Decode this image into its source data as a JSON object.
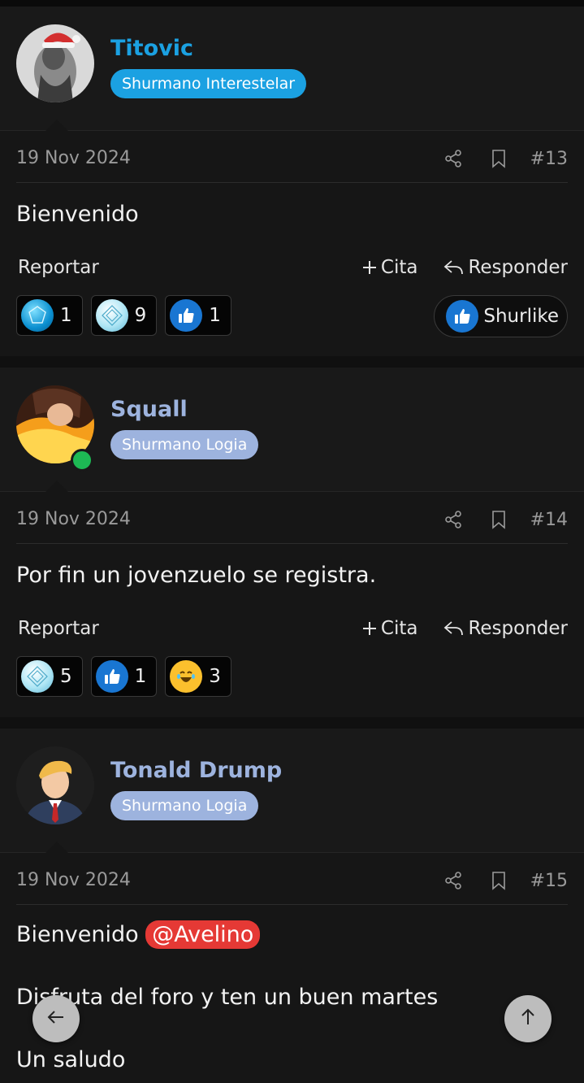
{
  "colors": {
    "accent_cyan": "#1ba1e2",
    "accent_slate": "#9db3de",
    "mention_red": "#e53935",
    "online_green": "#1db954"
  },
  "posts": [
    {
      "username": "Titovic",
      "badge": "Shurmano Interestelar",
      "date": "19 Nov 2024",
      "number": "#13",
      "body": [
        "Bienvenido"
      ],
      "actions": {
        "report": "Reportar",
        "quote": "Cita",
        "reply": "Responder"
      },
      "reactions": [
        {
          "icon": "sapphire-icon",
          "count": "1"
        },
        {
          "icon": "diamond-icon",
          "count": "9"
        },
        {
          "icon": "thumbs-up-icon",
          "count": "1"
        }
      ],
      "like_button": "Shurlike"
    },
    {
      "username": "Squall",
      "badge": "Shurmano Logia",
      "date": "19 Nov 2024",
      "number": "#14",
      "online": true,
      "body": [
        "Por fin un jovenzuelo se registra."
      ],
      "actions": {
        "report": "Reportar",
        "quote": "Cita",
        "reply": "Responder"
      },
      "reactions": [
        {
          "icon": "diamond-icon",
          "count": "5"
        },
        {
          "icon": "thumbs-up-icon",
          "count": "1"
        },
        {
          "icon": "laughing-icon",
          "count": "3"
        }
      ]
    },
    {
      "username": "Tonald Drump",
      "badge": "Shurmano Logia",
      "date": "19 Nov 2024",
      "number": "#15",
      "body_prefix": "Bienvenido",
      "mention": "@Avelino",
      "body_lines": [
        "Disfruta del foro y ten un buen martes",
        "Un saludo"
      ]
    }
  ],
  "nav": {
    "back_icon": "arrow-left-icon",
    "top_icon": "arrow-up-icon"
  }
}
